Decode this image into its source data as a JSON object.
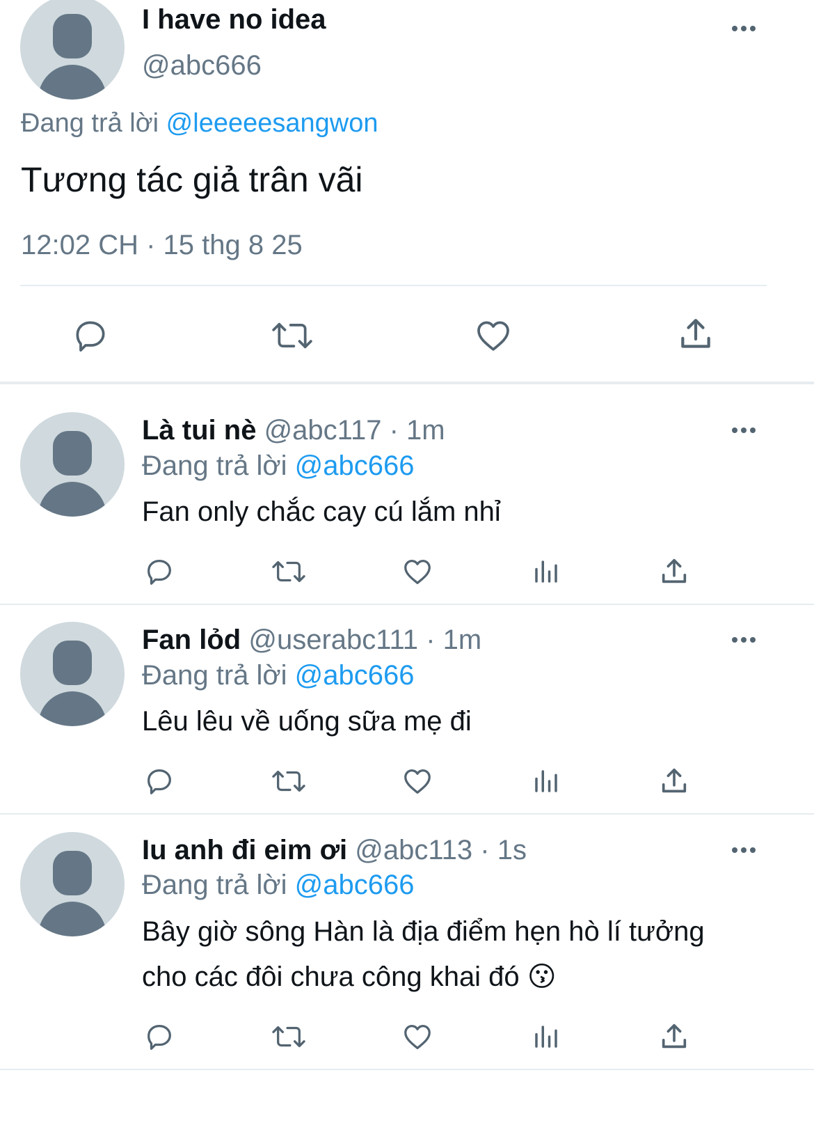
{
  "main_tweet": {
    "display_name": "I have no idea",
    "handle": "@abc666",
    "replying_prefix": "Đang trả lời",
    "replying_to": "@leeeeesangwon",
    "text": "Tương tác giả trân vãi",
    "timestamp": "12:02 CH · 15 thg 8 25",
    "actions": [
      "reply-icon",
      "retweet-icon",
      "like-icon",
      "share-icon"
    ]
  },
  "replies": [
    {
      "display_name": "Là tui nè",
      "handle": "@abc117",
      "time": "· 1m",
      "replying_prefix": "Đang trả lời",
      "replying_to": "@abc666",
      "text_lines": [
        "Fan only chắc cay cú lắm nhỉ"
      ]
    },
    {
      "display_name": "Fan lỏd",
      "handle": "@userabc111",
      "time": "· 1m",
      "replying_prefix": "Đang trả lời",
      "replying_to": "@abc666",
      "text_lines": [
        "Lêu lêu về uống sữa mẹ đi"
      ]
    },
    {
      "display_name": "Iu anh đi eim ơi",
      "handle": "@abc113",
      "time": "· 1s",
      "replying_prefix": "Đang trả lời",
      "replying_to": "@abc666",
      "text_lines": [
        "Bây giờ sông Hàn là địa điểm hẹn hò lí tưởng",
        "cho các đôi chưa công khai đó"
      ],
      "emoji": "😗"
    }
  ],
  "colors": {
    "accent": "#1d9bf0",
    "muted": "#657786",
    "divider": "#e6ecf0",
    "avatar_bg": "#cfd9de",
    "avatar_fg": "#657786"
  }
}
